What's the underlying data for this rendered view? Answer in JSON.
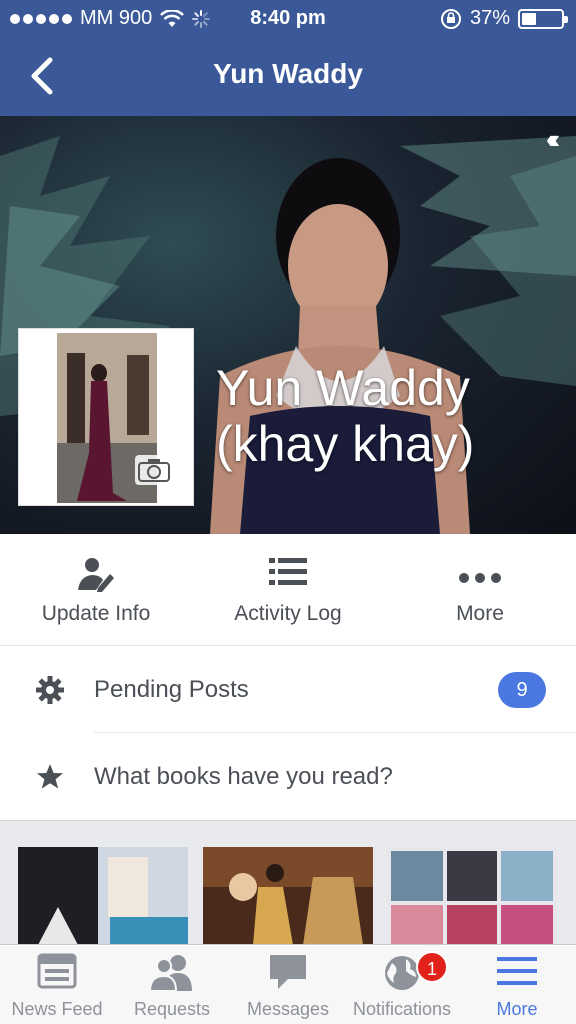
{
  "status_bar": {
    "carrier": "MM 900",
    "time": "8:40 pm",
    "battery_percent": "37%",
    "battery_level": 0.37
  },
  "navbar": {
    "title": "Yun Waddy",
    "back_icon": "chevron-left-icon"
  },
  "cover": {
    "name_line1": "Yun Waddy",
    "name_line2": "(khay khay)"
  },
  "actions": [
    {
      "label": "Update Info",
      "icon": "edit-profile-icon"
    },
    {
      "label": "Activity Log",
      "icon": "list-icon"
    },
    {
      "label": "More",
      "icon": "more-dots-icon"
    }
  ],
  "list": {
    "pending_label": "Pending Posts",
    "pending_count": "9",
    "books_label": "What books have you read?"
  },
  "tabbar": {
    "news_feed": "News Feed",
    "requests": "Requests",
    "messages": "Messages",
    "notifications": "Notifications",
    "notifications_badge": "1",
    "more": "More"
  },
  "colors": {
    "brand": "#3b5998",
    "accent": "#4a78e0",
    "badge": "#e0221b"
  }
}
